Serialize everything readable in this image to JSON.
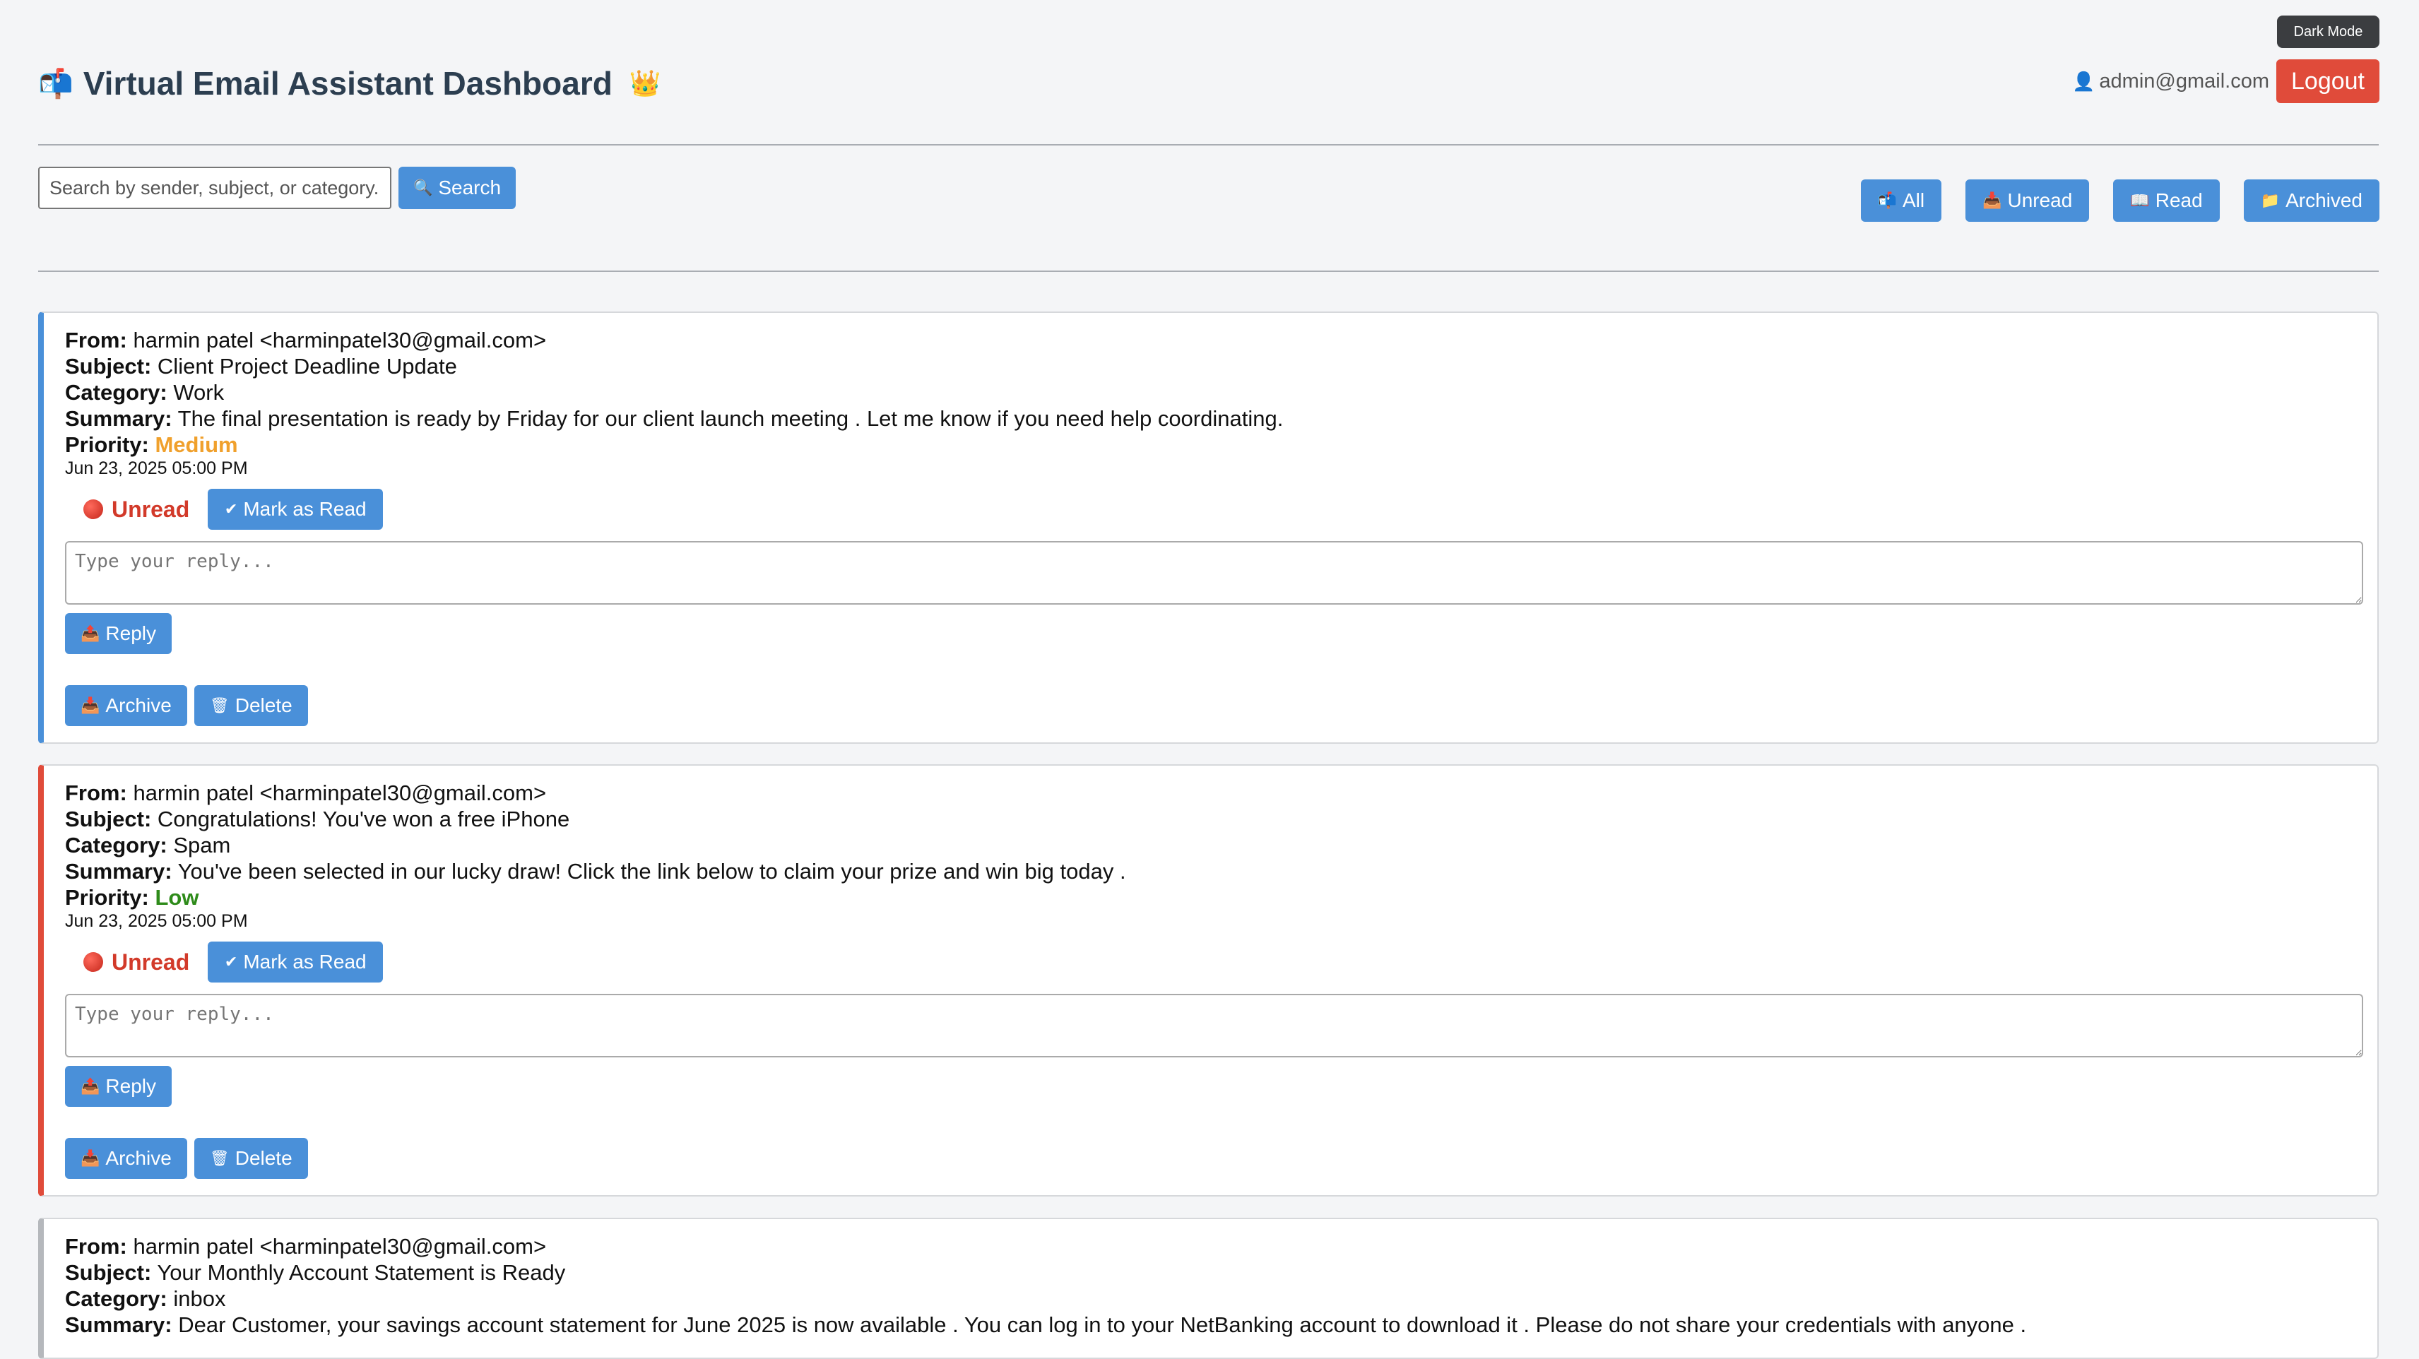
{
  "header": {
    "title": "Virtual Email Assistant Dashboard",
    "title_icon": "📬",
    "crown_icon": "👑",
    "dark_mode_label": "Dark Mode",
    "user_icon": "👤",
    "user_email": "admin@gmail.com",
    "logout_label": "Logout"
  },
  "search": {
    "placeholder": "Search by sender, subject, or category...",
    "button_icon": "🔍",
    "button_label": "Search"
  },
  "filters": [
    {
      "icon": "📬",
      "label": "All"
    },
    {
      "icon": "📥",
      "label": "Unread"
    },
    {
      "icon": "📖",
      "label": "Read"
    },
    {
      "icon": "📁",
      "label": "Archived"
    }
  ],
  "labels": {
    "from": "From:",
    "subject": "Subject:",
    "category": "Category:",
    "summary": "Summary:",
    "priority": "Priority:",
    "unread": "Unread",
    "mark_icon": "✔",
    "mark_read": "Mark as Read",
    "reply_placeholder": "Type your reply...",
    "reply_icon": "📤",
    "reply": "Reply",
    "archive_icon": "📥",
    "archive": "Archive",
    "delete_icon": "🗑",
    "delete": "Delete"
  },
  "emails": [
    {
      "from": "harmin patel <harminpatel30@gmail.com>",
      "subject": "Client Project Deadline Update",
      "category": "Work",
      "summary": "The final presentation is ready by Friday for our client launch meeting . Let me know if you need help coordinating.",
      "priority": "Medium",
      "date": "Jun 23, 2025 05:00 PM",
      "border_color": "#4a90d9",
      "priority_color": "#f0a02c"
    },
    {
      "from": "harmin patel <harminpatel30@gmail.com>",
      "subject": "Congratulations! You've won a free iPhone",
      "category": "Spam",
      "summary": "You've been selected in our lucky draw! Click the link below to claim your prize and win big today .",
      "priority": "Low",
      "date": "Jun 23, 2025 05:00 PM",
      "border_color": "#e04b3a",
      "priority_color": "#2e8b1a"
    },
    {
      "from": "harmin patel <harminpatel30@gmail.com>",
      "subject": "Your Monthly Account Statement is Ready",
      "category": "inbox",
      "summary": "Dear Customer, your savings account statement for June 2025 is now available . You can log in to your NetBanking account to download it . Please do not share your credentials with anyone .",
      "border_color": "#b5b8bc"
    }
  ]
}
